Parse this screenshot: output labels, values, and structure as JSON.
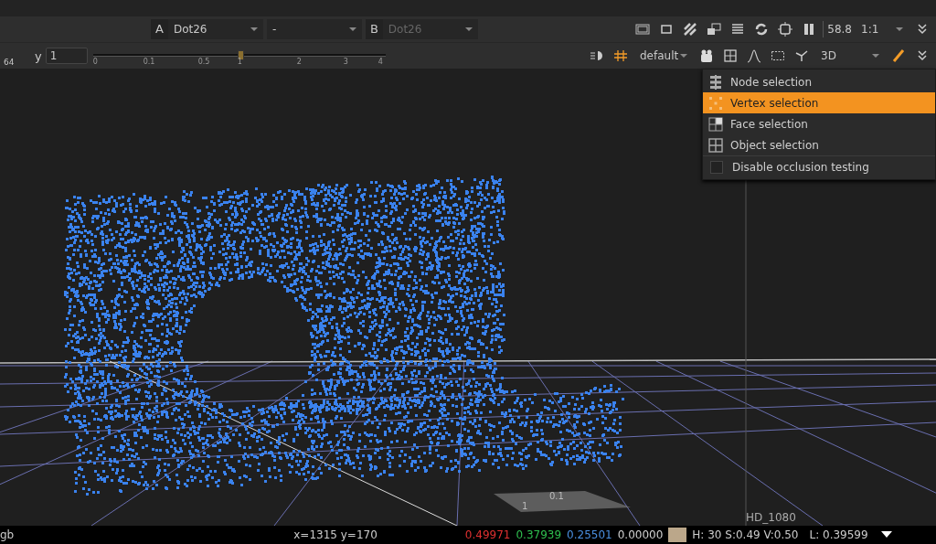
{
  "input_a": {
    "letter": "A",
    "value": "Dot26"
  },
  "operation": {
    "value": "-"
  },
  "input_b": {
    "letter": "B",
    "value": "Dot26",
    "disabled": true
  },
  "zoom_readout": "58.8",
  "scale": {
    "value": "1:1"
  },
  "gain": {
    "cut_label": "64"
  },
  "gamma": {
    "label": "y",
    "value": "1",
    "level": 0.5,
    "ticks": [
      "0",
      "0.1",
      "0.5",
      "1",
      "2",
      "3",
      "4"
    ]
  },
  "lut": {
    "value": "default"
  },
  "view_mode": {
    "value": "3D"
  },
  "selection_menu": [
    {
      "kind": "item",
      "label": "Node selection",
      "selected": false
    },
    {
      "kind": "item",
      "label": "Vertex selection",
      "selected": true
    },
    {
      "kind": "item",
      "label": "Face selection",
      "selected": false
    },
    {
      "kind": "item",
      "label": "Object selection",
      "selected": false
    },
    {
      "kind": "checkbox",
      "label": "Disable occlusion testing",
      "checked": false
    }
  ],
  "viewport": {
    "grid_labels": [
      "0.1",
      "1"
    ],
    "format": "HD_1080"
  },
  "status_bar": {
    "channels": "gb",
    "coords": "x=1315 y=170",
    "values": [
      {
        "text": "0.49971",
        "color": "#e03030"
      },
      {
        "text": "0.37939",
        "color": "#2fbf4f"
      },
      {
        "text": "0.25501",
        "color": "#4a8fe0"
      },
      {
        "text": "0.00000",
        "color": "#d0d0d0"
      }
    ],
    "swatch": {
      "color": "#bba78a"
    },
    "hsv": "H: 30 S:0.49 V:0.50",
    "luminance": "L: 0.39599"
  }
}
